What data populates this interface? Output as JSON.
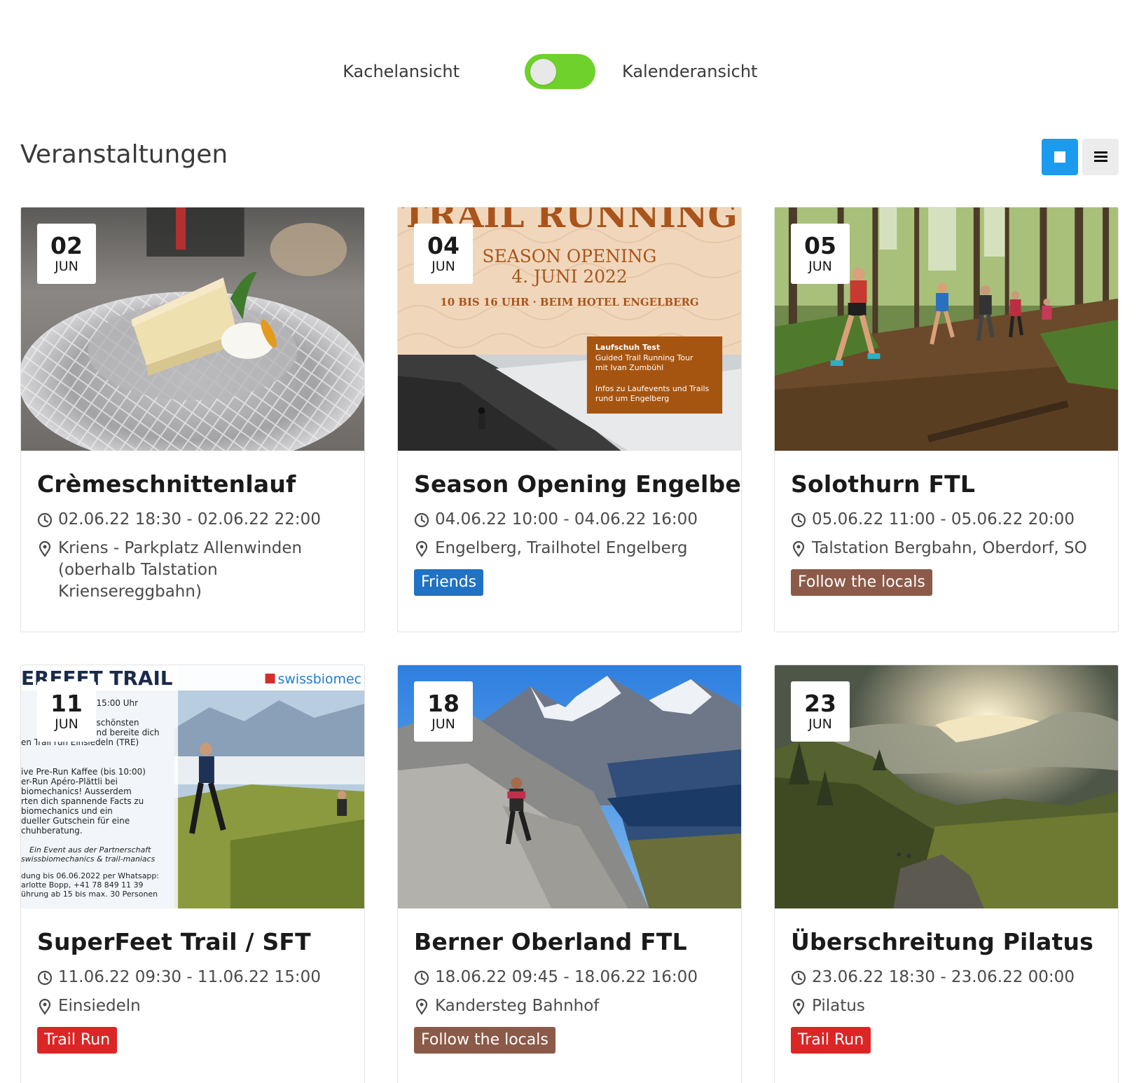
{
  "view_toggle": {
    "left_label": "Kachelansicht",
    "right_label": "Kalenderansicht"
  },
  "header": {
    "title": "Veranstaltungen"
  },
  "colors": {
    "accent": "#1a9bf0",
    "toggle_on": "#6fd12b",
    "tag_friends": "#1f72c4",
    "tag_follow": "#8b5a48",
    "tag_trail_run": "#dc2626"
  },
  "events": [
    {
      "day": "02",
      "month": "JUN",
      "title": "Crèmeschnittenlauf",
      "time": "02.06.22 18:30 - 02.06.22 22:00",
      "location": "Kriens - Parkplatz Allenwinden (oberhalb Talstation Kriensereggbahn)",
      "tag": ""
    },
    {
      "day": "04",
      "month": "JUN",
      "title": "Season Opening Engelberg",
      "time": "04.06.22 10:00 - 04.06.22 16:00",
      "location": "Engelberg, Trailhotel Engelberg",
      "tag": "Friends",
      "poster": {
        "headline": "TRAIL RUNNING",
        "line1": "SEASON OPENING",
        "line2": "4. JUNI 2022",
        "line3": "10 BIS 16 UHR · BEIM HOTEL ENGELBERG",
        "box_title": "Laufschuh Test",
        "box_line1": "Guided Trail Running Tour",
        "box_line2": "mit Ivan Zumbühl",
        "box_line3": "Infos zu Laufevents und Trails",
        "box_line4": "rund um Engelberg"
      }
    },
    {
      "day": "05",
      "month": "JUN",
      "title": "Solothurn FTL",
      "time": "05.06.22 11:00 - 05.06.22 20:00",
      "location": "Talstation Bergbahn, Oberdorf, SO",
      "tag": "Follow the locals"
    },
    {
      "day": "11",
      "month": "JUN",
      "title": "SuperFeet Trail / SFT",
      "time": "11.06.22 09:30 - 11.06.22 15:00",
      "location": "Einsiedeln",
      "tag": "Trail Run",
      "poster": {
        "headline": "ERFEET TRAIL",
        "brand": "swissbiomec",
        "lines": [
          "15:00 Uhr",
          "schönsten",
          "nd bereite dich",
          "en Trail run Einsiedeln (TRE)",
          "ive Pre-Run Kaffee (bis 10:00)",
          "er-Run Apéro-Plättli bei",
          "biomechanics! Ausserdem",
          "rten dich spannende Facts zu",
          "biomechanics und ein",
          "dueller Gutschein für eine",
          "chuhberatung.",
          "Ein Event aus der Partnerschaft",
          "swissbiomechanics & trail-maniacs",
          "dung bis 06.06.2022 per Whatsapp:",
          "arlotte Bopp, +41 78 849 11 39",
          "ührung ab 15 bis max. 30 Personen"
        ]
      }
    },
    {
      "day": "18",
      "month": "JUN",
      "title": "Berner Oberland FTL",
      "time": "18.06.22 09:45 - 18.06.22 16:00",
      "location": "Kandersteg Bahnhof",
      "tag": "Follow the locals"
    },
    {
      "day": "23",
      "month": "JUN",
      "title": "Überschreitung Pilatus",
      "time": "23.06.22 18:30 - 23.06.22 00:00",
      "location": "Pilatus",
      "tag": "Trail Run"
    }
  ]
}
